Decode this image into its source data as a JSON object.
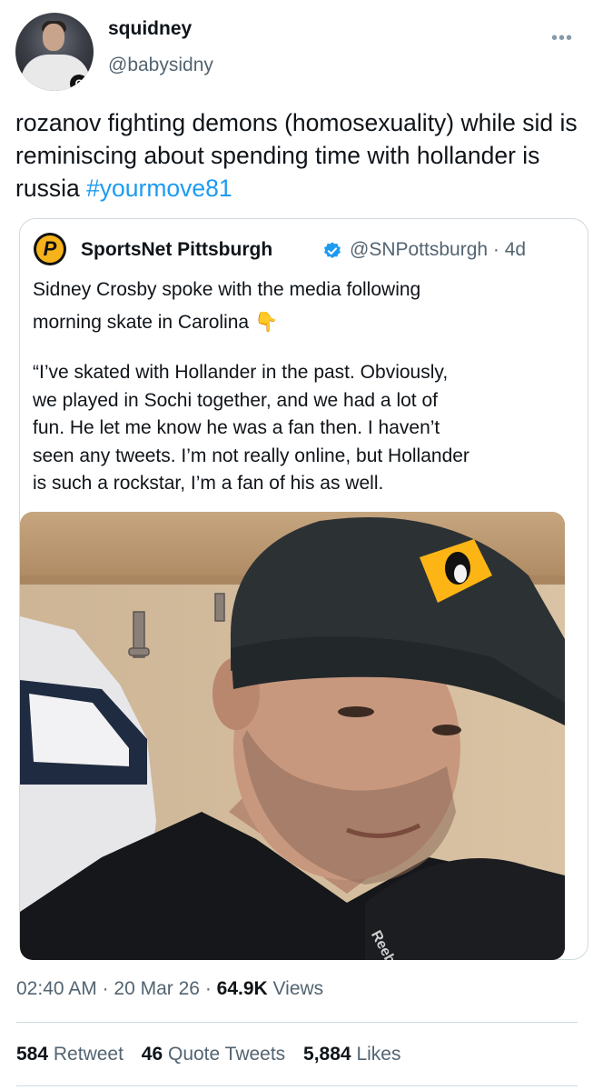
{
  "tweet": {
    "display_name": "squidney",
    "handle": "@babysidny",
    "text_main": "rozanov fighting demons (homosexuality) while sid is reminiscing about spending time with hollander is russia ",
    "hashtag": "#yourmove81",
    "more_icon": "more-horizontal-icon",
    "avatar_badge": "C"
  },
  "quote": {
    "logo_letter": "P",
    "name": "SportsNet Pittsburgh",
    "handle_time": "@SNPottsburgh · 4d",
    "line1": "Sidney Crosby spoke with the media following",
    "line2": "morning skate in Carolina 👇",
    "para2": [
      "“I’ve skated with Hollander in the past. Obviously,",
      "we played in Sochi together, and we had a lot of",
      "fun. He let me know he was a fan then. I haven’t",
      "seen any tweets. I’m not really online, but Hollander",
      "is such a rockstar, I’m a fan of his as well."
    ],
    "media_cap_text": "Reebok",
    "verified_color": "#1d9bf0"
  },
  "meta": {
    "time": "02:40 AM",
    "date": "20 Mar 26",
    "views_count": "64.9K",
    "views_label": "Views"
  },
  "stats": {
    "retweets_count": "584",
    "retweets_label": "Retweet",
    "quotes_count": "46",
    "quotes_label": "Quote Tweets",
    "likes_count": "5,884",
    "likes_label": "Likes"
  }
}
